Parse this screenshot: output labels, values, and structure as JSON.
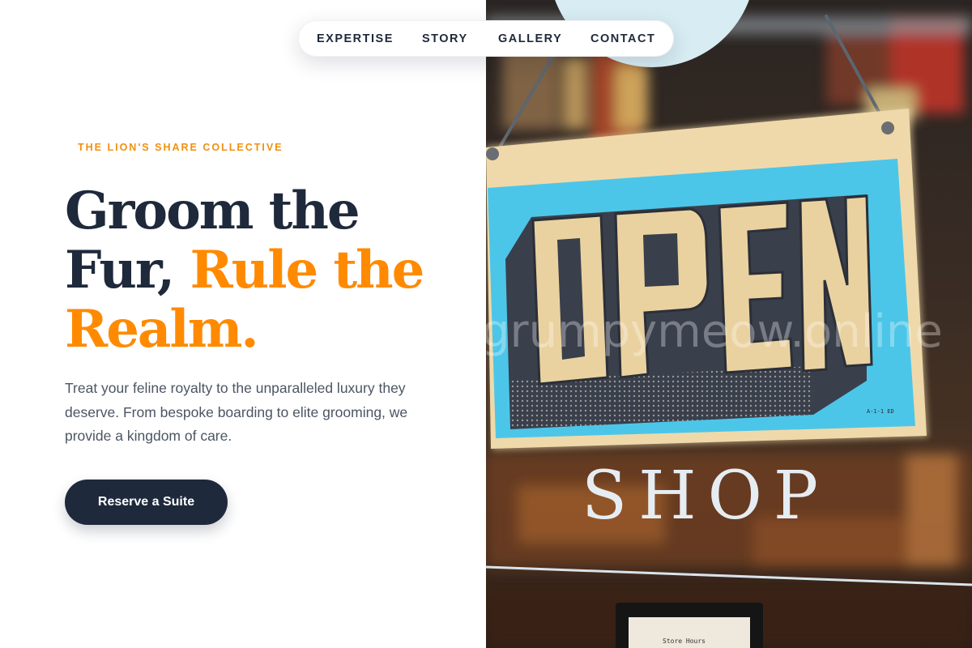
{
  "nav": {
    "items": [
      {
        "label": "EXPERTISE"
      },
      {
        "label": "STORY"
      },
      {
        "label": "GALLERY"
      },
      {
        "label": "CONTACT"
      }
    ]
  },
  "hero": {
    "eyebrow": "THE LION'S SHARE COLLECTIVE",
    "headline_line1": "Groom the",
    "headline_line2_plain": "Fur, ",
    "headline_line2_accent": "Rule the",
    "headline_line3_accent": "Realm.",
    "lede": "Treat your feline royalty to the unparalleled luxury they deserve. From bespoke boarding to elite grooming, we provide a kingdom of care.",
    "cta_label": "Reserve a Suite"
  },
  "photo": {
    "sign_text": "OPEN",
    "window_text": "SHOP",
    "watermark": "grumpymeow.online",
    "small_card_text": "Store Hours"
  },
  "colors": {
    "navy": "#1e293b",
    "accent_orange": "#ff8a00",
    "eyebrow_orange": "#f0900f",
    "body_gray": "#4b5563",
    "sign_cyan": "#4cc6e8",
    "sign_cream": "#efd9aa"
  },
  "icons": []
}
